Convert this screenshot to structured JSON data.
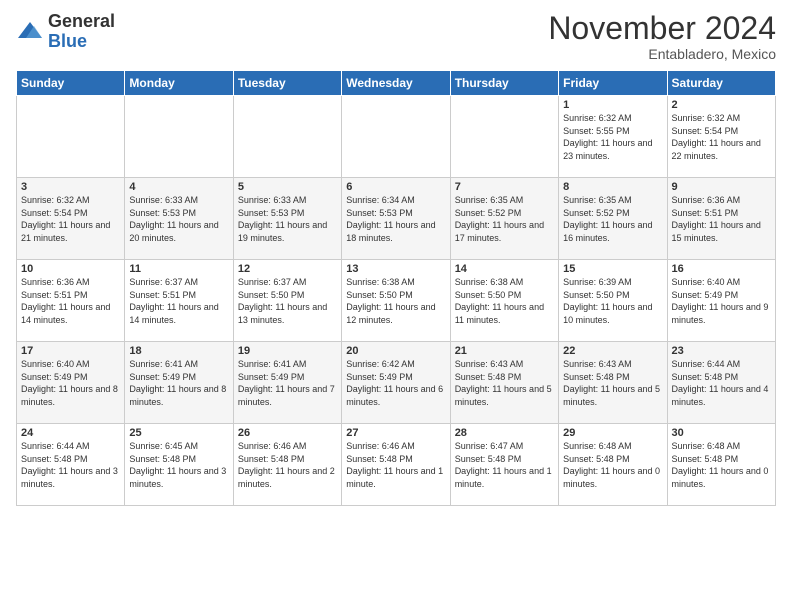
{
  "header": {
    "logo_general": "General",
    "logo_blue": "Blue",
    "month_title": "November 2024",
    "location": "Entabladero, Mexico"
  },
  "days_of_week": [
    "Sunday",
    "Monday",
    "Tuesday",
    "Wednesday",
    "Thursday",
    "Friday",
    "Saturday"
  ],
  "weeks": [
    [
      {
        "day": "",
        "info": ""
      },
      {
        "day": "",
        "info": ""
      },
      {
        "day": "",
        "info": ""
      },
      {
        "day": "",
        "info": ""
      },
      {
        "day": "",
        "info": ""
      },
      {
        "day": "1",
        "info": "Sunrise: 6:32 AM\nSunset: 5:55 PM\nDaylight: 11 hours and 23 minutes."
      },
      {
        "day": "2",
        "info": "Sunrise: 6:32 AM\nSunset: 5:54 PM\nDaylight: 11 hours and 22 minutes."
      }
    ],
    [
      {
        "day": "3",
        "info": "Sunrise: 6:32 AM\nSunset: 5:54 PM\nDaylight: 11 hours and 21 minutes."
      },
      {
        "day": "4",
        "info": "Sunrise: 6:33 AM\nSunset: 5:53 PM\nDaylight: 11 hours and 20 minutes."
      },
      {
        "day": "5",
        "info": "Sunrise: 6:33 AM\nSunset: 5:53 PM\nDaylight: 11 hours and 19 minutes."
      },
      {
        "day": "6",
        "info": "Sunrise: 6:34 AM\nSunset: 5:53 PM\nDaylight: 11 hours and 18 minutes."
      },
      {
        "day": "7",
        "info": "Sunrise: 6:35 AM\nSunset: 5:52 PM\nDaylight: 11 hours and 17 minutes."
      },
      {
        "day": "8",
        "info": "Sunrise: 6:35 AM\nSunset: 5:52 PM\nDaylight: 11 hours and 16 minutes."
      },
      {
        "day": "9",
        "info": "Sunrise: 6:36 AM\nSunset: 5:51 PM\nDaylight: 11 hours and 15 minutes."
      }
    ],
    [
      {
        "day": "10",
        "info": "Sunrise: 6:36 AM\nSunset: 5:51 PM\nDaylight: 11 hours and 14 minutes."
      },
      {
        "day": "11",
        "info": "Sunrise: 6:37 AM\nSunset: 5:51 PM\nDaylight: 11 hours and 14 minutes."
      },
      {
        "day": "12",
        "info": "Sunrise: 6:37 AM\nSunset: 5:50 PM\nDaylight: 11 hours and 13 minutes."
      },
      {
        "day": "13",
        "info": "Sunrise: 6:38 AM\nSunset: 5:50 PM\nDaylight: 11 hours and 12 minutes."
      },
      {
        "day": "14",
        "info": "Sunrise: 6:38 AM\nSunset: 5:50 PM\nDaylight: 11 hours and 11 minutes."
      },
      {
        "day": "15",
        "info": "Sunrise: 6:39 AM\nSunset: 5:50 PM\nDaylight: 11 hours and 10 minutes."
      },
      {
        "day": "16",
        "info": "Sunrise: 6:40 AM\nSunset: 5:49 PM\nDaylight: 11 hours and 9 minutes."
      }
    ],
    [
      {
        "day": "17",
        "info": "Sunrise: 6:40 AM\nSunset: 5:49 PM\nDaylight: 11 hours and 8 minutes."
      },
      {
        "day": "18",
        "info": "Sunrise: 6:41 AM\nSunset: 5:49 PM\nDaylight: 11 hours and 8 minutes."
      },
      {
        "day": "19",
        "info": "Sunrise: 6:41 AM\nSunset: 5:49 PM\nDaylight: 11 hours and 7 minutes."
      },
      {
        "day": "20",
        "info": "Sunrise: 6:42 AM\nSunset: 5:49 PM\nDaylight: 11 hours and 6 minutes."
      },
      {
        "day": "21",
        "info": "Sunrise: 6:43 AM\nSunset: 5:48 PM\nDaylight: 11 hours and 5 minutes."
      },
      {
        "day": "22",
        "info": "Sunrise: 6:43 AM\nSunset: 5:48 PM\nDaylight: 11 hours and 5 minutes."
      },
      {
        "day": "23",
        "info": "Sunrise: 6:44 AM\nSunset: 5:48 PM\nDaylight: 11 hours and 4 minutes."
      }
    ],
    [
      {
        "day": "24",
        "info": "Sunrise: 6:44 AM\nSunset: 5:48 PM\nDaylight: 11 hours and 3 minutes."
      },
      {
        "day": "25",
        "info": "Sunrise: 6:45 AM\nSunset: 5:48 PM\nDaylight: 11 hours and 3 minutes."
      },
      {
        "day": "26",
        "info": "Sunrise: 6:46 AM\nSunset: 5:48 PM\nDaylight: 11 hours and 2 minutes."
      },
      {
        "day": "27",
        "info": "Sunrise: 6:46 AM\nSunset: 5:48 PM\nDaylight: 11 hours and 1 minute."
      },
      {
        "day": "28",
        "info": "Sunrise: 6:47 AM\nSunset: 5:48 PM\nDaylight: 11 hours and 1 minute."
      },
      {
        "day": "29",
        "info": "Sunrise: 6:48 AM\nSunset: 5:48 PM\nDaylight: 11 hours and 0 minutes."
      },
      {
        "day": "30",
        "info": "Sunrise: 6:48 AM\nSunset: 5:48 PM\nDaylight: 11 hours and 0 minutes."
      }
    ]
  ]
}
